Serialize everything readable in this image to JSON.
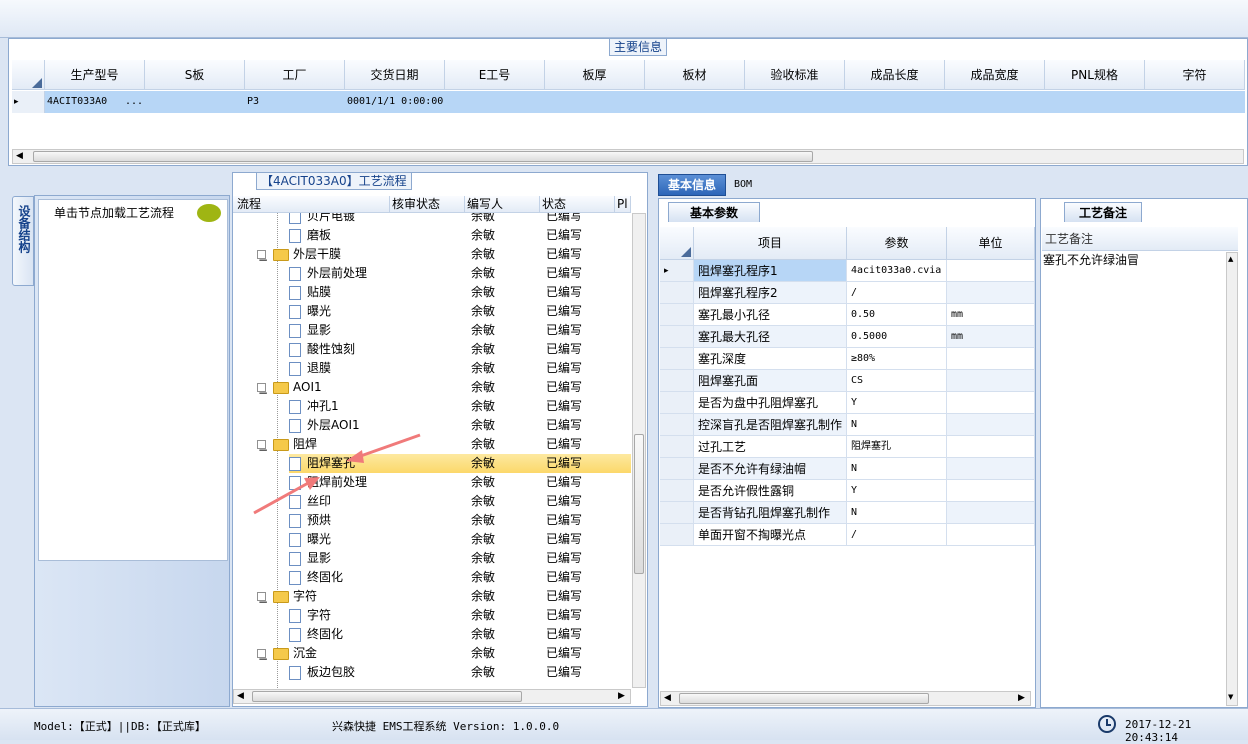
{
  "main_info": {
    "title": "主要信息",
    "columns": [
      "生产型号",
      "S板",
      "工厂",
      "交货日期",
      "E工号",
      "板厚",
      "板材",
      "验收标准",
      "成品长度",
      "成品宽度",
      "PNL规格",
      "字符"
    ],
    "row": {
      "indicator": "▸",
      "model": "4ACIT033A0",
      "ellipsis": "...",
      "factory": "P3",
      "delivery": "0001/1/1 0:00:00"
    }
  },
  "left_panel": {
    "vertical_tab": "设备结构",
    "hint": "单击节点加载工艺流程"
  },
  "process_panel": {
    "title": "【4ACIT033A0】工艺流程",
    "columns": [
      "流程",
      "核审状态",
      "编写人",
      "状态",
      "Pl"
    ],
    "rows": [
      {
        "label": "贝片电镀",
        "type": "doc",
        "level": 2,
        "writer": "余敏",
        "status": "已编写"
      },
      {
        "label": "磨板",
        "type": "doc",
        "level": 2,
        "writer": "余敏",
        "status": "已编写"
      },
      {
        "label": "外层干膜",
        "type": "folder",
        "level": 1,
        "writer": "余敏",
        "status": "已编写"
      },
      {
        "label": "外层前处理",
        "type": "doc",
        "level": 2,
        "writer": "余敏",
        "status": "已编写"
      },
      {
        "label": "贴膜",
        "type": "doc",
        "level": 2,
        "writer": "余敏",
        "status": "已编写"
      },
      {
        "label": "曝光",
        "type": "doc",
        "level": 2,
        "writer": "余敏",
        "status": "已编写"
      },
      {
        "label": "显影",
        "type": "doc",
        "level": 2,
        "writer": "余敏",
        "status": "已编写"
      },
      {
        "label": "酸性蚀刻",
        "type": "doc",
        "level": 2,
        "writer": "余敏",
        "status": "已编写"
      },
      {
        "label": "退膜",
        "type": "doc",
        "level": 2,
        "writer": "余敏",
        "status": "已编写"
      },
      {
        "label": "AOI1",
        "type": "folder",
        "level": 1,
        "writer": "余敏",
        "status": "已编写"
      },
      {
        "label": "冲孔1",
        "type": "doc",
        "level": 2,
        "writer": "余敏",
        "status": "已编写"
      },
      {
        "label": "外层AOI1",
        "type": "doc",
        "level": 2,
        "writer": "余敏",
        "status": "已编写"
      },
      {
        "label": "阻焊",
        "type": "folder",
        "level": 1,
        "writer": "余敏",
        "status": "已编写"
      },
      {
        "label": "阻焊塞孔",
        "type": "doc",
        "level": 2,
        "writer": "余敏",
        "status": "已编写",
        "selected": true
      },
      {
        "label": "阻焊前处理",
        "type": "doc",
        "level": 2,
        "writer": "余敏",
        "status": "已编写"
      },
      {
        "label": "丝印",
        "type": "doc",
        "level": 2,
        "writer": "余敏",
        "status": "已编写"
      },
      {
        "label": "预烘",
        "type": "doc",
        "level": 2,
        "writer": "余敏",
        "status": "已编写"
      },
      {
        "label": "曝光",
        "type": "doc",
        "level": 2,
        "writer": "余敏",
        "status": "已编写"
      },
      {
        "label": "显影",
        "type": "doc",
        "level": 2,
        "writer": "余敏",
        "status": "已编写"
      },
      {
        "label": "终固化",
        "type": "doc",
        "level": 2,
        "writer": "余敏",
        "status": "已编写"
      },
      {
        "label": "字符",
        "type": "folder",
        "level": 1,
        "writer": "余敏",
        "status": "已编写"
      },
      {
        "label": "字符",
        "type": "doc",
        "level": 2,
        "writer": "余敏",
        "status": "已编写"
      },
      {
        "label": "终固化",
        "type": "doc",
        "level": 2,
        "writer": "余敏",
        "status": "已编写"
      },
      {
        "label": "沉金",
        "type": "folder",
        "level": 1,
        "writer": "余敏",
        "status": "已编写"
      },
      {
        "label": "板边包胶",
        "type": "doc",
        "level": 2,
        "writer": "余敏",
        "status": "已编写"
      }
    ]
  },
  "tabs": {
    "basic": "基本信息",
    "bom": "BOM"
  },
  "params_panel": {
    "title": "基本参数",
    "columns": [
      "项目",
      "参数",
      "单位"
    ],
    "rows": [
      {
        "item": "阻焊塞孔程序1",
        "value": "4acit033a0.cvia",
        "unit": "",
        "current": true
      },
      {
        "item": "阻焊塞孔程序2",
        "value": "/",
        "unit": ""
      },
      {
        "item": "塞孔最小孔径",
        "value": "0.50",
        "unit": "mm"
      },
      {
        "item": "塞孔最大孔径",
        "value": "0.5000",
        "unit": "mm"
      },
      {
        "item": "塞孔深度",
        "value": "≥80%",
        "unit": ""
      },
      {
        "item": "阻焊塞孔面",
        "value": "CS",
        "unit": ""
      },
      {
        "item": "是否为盘中孔阻焊塞孔",
        "value": "Y",
        "unit": ""
      },
      {
        "item": "控深盲孔是否阻焊塞孔制作",
        "value": "N",
        "unit": ""
      },
      {
        "item": "过孔工艺",
        "value": "阻焊塞孔",
        "unit": ""
      },
      {
        "item": "是否不允许有绿油帽",
        "value": "N",
        "unit": ""
      },
      {
        "item": "是否允许假性露铜",
        "value": "Y",
        "unit": ""
      },
      {
        "item": "是否背钻孔阻焊塞孔制作",
        "value": "N",
        "unit": ""
      },
      {
        "item": "单面开窗不掏曝光点",
        "value": "/",
        "unit": ""
      }
    ]
  },
  "remarks_panel": {
    "title": "工艺备注",
    "column": "工艺备注",
    "text": "塞孔不允许绿油冒"
  },
  "status_bar": {
    "model": "Model:【正式】||DB:【正式库】",
    "app": "兴森快捷 EMS工程系统 Version: 1.0.0.0",
    "datetime": "2017-12-21 20:43:14"
  },
  "colors": {
    "selection": "#b7d6f6",
    "highlight": "#fcd86a",
    "annotation_arrow": "#f07a7a",
    "accent": "#15428b"
  }
}
